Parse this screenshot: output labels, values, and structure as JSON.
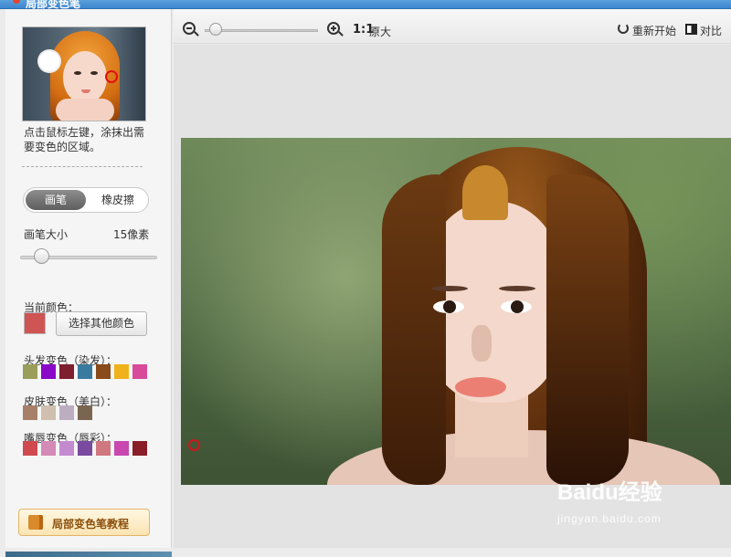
{
  "window": {
    "title": "局部变色笔"
  },
  "sidebar": {
    "hint": "点击鼠标左键，涂抹出需要变色的区域。",
    "tools": {
      "brush": "画笔",
      "eraser": "橡皮擦",
      "selected": "brush"
    },
    "brush_size": {
      "label": "画笔大小",
      "value": "15像素",
      "slider_fraction": 0.15
    },
    "current_color": {
      "label": "当前颜色：",
      "value": "#cf5454",
      "button": "选择其他颜色"
    },
    "hair": {
      "label": "头发变色（染发）：",
      "colors": [
        "#9a9e5a",
        "#8a08c8",
        "#7e1e2e",
        "#3a7aa0",
        "#8a4a1a",
        "#f0b21a",
        "#d84a9a"
      ]
    },
    "skin": {
      "label": "皮肤变色（美白）：",
      "colors": [
        "#a8806a",
        "#d0bfae",
        "#bcaec0",
        "#7a6650"
      ]
    },
    "lips": {
      "label": "嘴唇变色（唇彩）：",
      "colors": [
        "#d04a50",
        "#d48ab6",
        "#c48ad0",
        "#7a4aa0",
        "#d07880",
        "#c848b0",
        "#8a1e28"
      ]
    },
    "tutorial": "局部变色笔教程"
  },
  "toolbar": {
    "zoom_fraction": 0.1,
    "ratio": "1:1",
    "original": "原大",
    "restart": "重新开始",
    "compare": "对比"
  },
  "icons": {
    "zoom_out": "zoom-out-icon",
    "zoom_in": "zoom-in-icon",
    "restart": "undo-icon",
    "compare": "compare-icon",
    "tutorial": "book-icon"
  },
  "watermark": {
    "brand": "Baidu经验",
    "url": "jingyan.baidu.com"
  }
}
